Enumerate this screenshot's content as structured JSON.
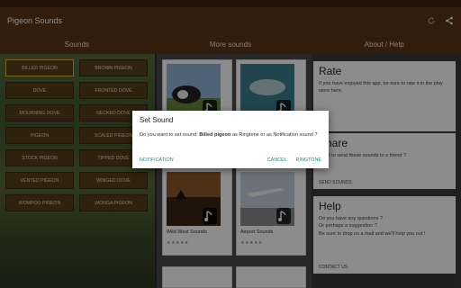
{
  "app": {
    "title": "Pigeon Sounds"
  },
  "tabs": [
    "Sounds",
    "More sounds",
    "About / Help"
  ],
  "sounds": [
    "BILLED PIGEON",
    "BROWN PIGEON",
    "DOVE",
    "FRONTED DOVE",
    "MOURNING DOVE",
    "NECKED DOVE",
    "PIGEON",
    "SCALED PIGEON",
    "STOCK PIGEON",
    "TIPPED DOVE",
    "VENTED PIGEON",
    "WINGED DOVE",
    "WOMPOO PIGEON",
    "WONGA PIGEON"
  ],
  "more_sounds": {
    "items": [
      {
        "label": "Wild West Sounds",
        "stars": "★★★★★"
      },
      {
        "label": "Airport Sounds",
        "stars": "★★★★★"
      }
    ]
  },
  "about": {
    "rate": {
      "title": "Rate",
      "text": "If you have enjoyed this app, be sure to rate it in the play store here."
    },
    "share": {
      "title": "Share",
      "text": "Want to send these sounds to a friend ?",
      "link": "SEND SOUNDS"
    },
    "help": {
      "title": "Help",
      "line1": "Do you have any questions ?",
      "line2": "Or perhaps a suggestion ?",
      "line3": "Be sure to drop us a mail and we'll help you out !",
      "link": "CONTACT US"
    }
  },
  "dialog": {
    "title": "Set Sound",
    "msg_prefix": "Do you want to set sound:",
    "sound_name": "Billed pigeon",
    "msg_suffix": "as Ringtone or as Notification sound ?",
    "notification": "NOTIFICATION",
    "cancel": "CANCEL",
    "ringtone": "RINGTONE"
  }
}
